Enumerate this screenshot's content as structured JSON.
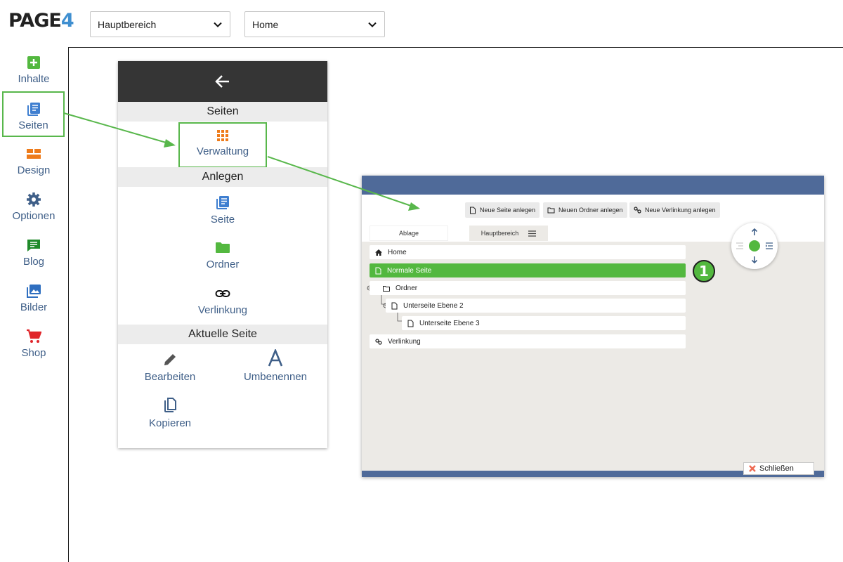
{
  "app": {
    "logo_text": "PAGE",
    "logo_number": "4",
    "brand_color": "#3f8fd0"
  },
  "toolbar": {
    "area_select": "Hauptbereich",
    "page_select": "Home"
  },
  "sidebar": {
    "items": [
      {
        "label": "Inhalte",
        "icon": "add-box-icon",
        "color": "#53b83f"
      },
      {
        "label": "Seiten",
        "icon": "pages-icon",
        "color": "#3f7fd0",
        "highlighted": true
      },
      {
        "label": "Design",
        "icon": "layout-icon",
        "color": "#ee7b1a"
      },
      {
        "label": "Optionen",
        "icon": "gear-icon",
        "color": "#3f5f88"
      },
      {
        "label": "Blog",
        "icon": "comment-icon",
        "color": "#1f8a2a"
      },
      {
        "label": "Bilder",
        "icon": "images-icon",
        "color": "#2f6fc0"
      },
      {
        "label": "Shop",
        "icon": "cart-icon",
        "color": "#e0252a"
      }
    ]
  },
  "menu": {
    "back_icon": "arrow-left-icon",
    "sections": {
      "seiten": "Seiten",
      "anlegen": "Anlegen",
      "aktuelle_seite": "Aktuelle Seite"
    },
    "items": {
      "verwaltung": "Verwaltung",
      "seite": "Seite",
      "ordner": "Ordner",
      "verlinkung": "Verlinkung",
      "bearbeiten": "Bearbeiten",
      "umbenennen": "Umbenennen",
      "kopieren": "Kopieren"
    }
  },
  "screenshot": {
    "buttons": {
      "new_page": "Neue Seite anlegen",
      "new_folder": "Neuen Ordner anlegen",
      "new_link": "Neue Verlinkung anlegen"
    },
    "tabs": {
      "ablage": "Ablage",
      "hauptbereich": "Hauptbereich"
    },
    "tree": [
      {
        "label": "Home",
        "icon": "home-icon"
      },
      {
        "label": "Normale Seite",
        "icon": "page-icon",
        "active": true
      },
      {
        "label": "Ordner",
        "icon": "folder-icon"
      },
      {
        "label": "Unterseite Ebene 2",
        "icon": "page-icon"
      },
      {
        "label": "Unterseite Ebene 3",
        "icon": "page-icon"
      },
      {
        "label": "Verlinkung",
        "icon": "link-icon"
      }
    ],
    "badge": "1",
    "close_label": "Schließen"
  },
  "colors": {
    "highlight": "#58b74b",
    "link": "#3f5f88",
    "dark_header": "#353535",
    "window_bar": "#4f6a99"
  }
}
